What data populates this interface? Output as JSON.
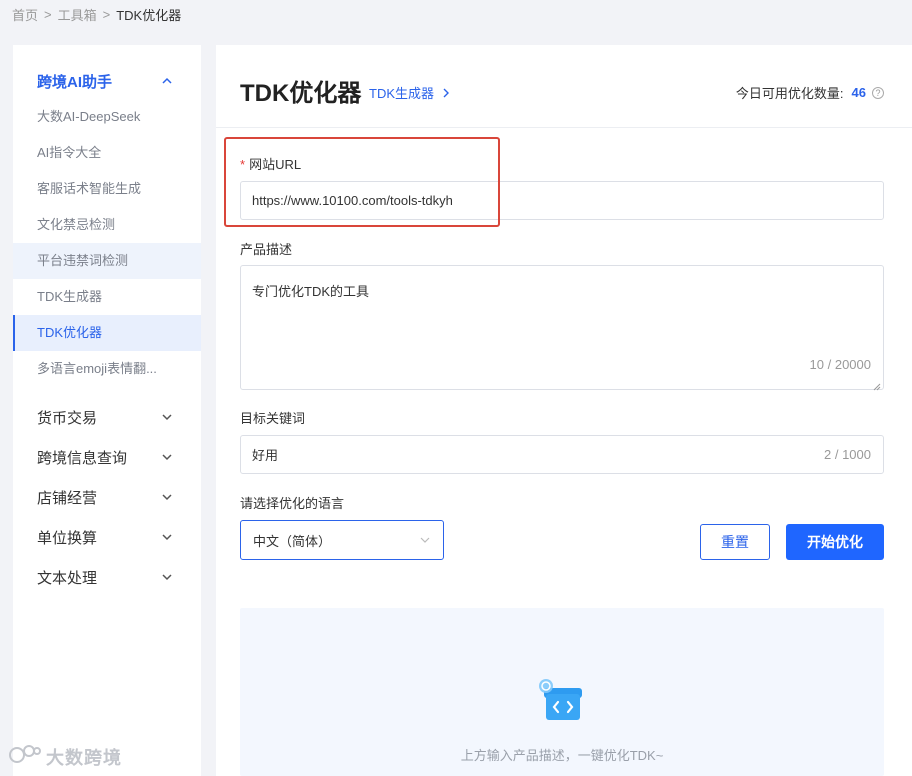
{
  "breadcrumb": {
    "items": [
      "首页",
      "工具箱",
      "TDK优化器"
    ],
    "separator": ">"
  },
  "sidebar": {
    "group": {
      "label": "跨境AI助手",
      "items": [
        {
          "label": "大数AI-DeepSeek"
        },
        {
          "label": "AI指令大全"
        },
        {
          "label": "客服话术智能生成"
        },
        {
          "label": "文化禁忌检测"
        },
        {
          "label": "平台违禁词检测"
        },
        {
          "label": "TDK生成器"
        },
        {
          "label": "TDK优化器"
        },
        {
          "label": "多语言emoji表情翻..."
        }
      ],
      "active_index": 6,
      "hover_index": 4
    },
    "categories": [
      {
        "label": "货币交易"
      },
      {
        "label": "跨境信息查询"
      },
      {
        "label": "店铺经营"
      },
      {
        "label": "单位换算"
      },
      {
        "label": "文本处理"
      }
    ]
  },
  "watermark": {
    "text": "大数跨境"
  },
  "header": {
    "title": "TDK优化器",
    "generator_link": "TDK生成器",
    "quota_label": "今日可用优化数量:",
    "quota_value": "46"
  },
  "form": {
    "url": {
      "label": "网站URL",
      "required_mark": "*",
      "value": "https://www.10100.com/tools-tdkyh"
    },
    "description": {
      "label": "产品描述",
      "value": "专门优化TDK的工具",
      "counter": "10 / 20000"
    },
    "keywords": {
      "label": "目标关键词",
      "value": "好用",
      "counter": "2 / 1000"
    },
    "language": {
      "label": "请选择优化的语言",
      "value": "中文（简体）"
    },
    "reset_label": "重置",
    "start_label": "开始优化"
  },
  "result": {
    "tip": "上方输入产品描述，一键优化TDK~"
  },
  "colors": {
    "accent": "#2b63ea",
    "primary_button": "#1f66ff",
    "highlight": "#d9463a",
    "required": "#e53935"
  }
}
